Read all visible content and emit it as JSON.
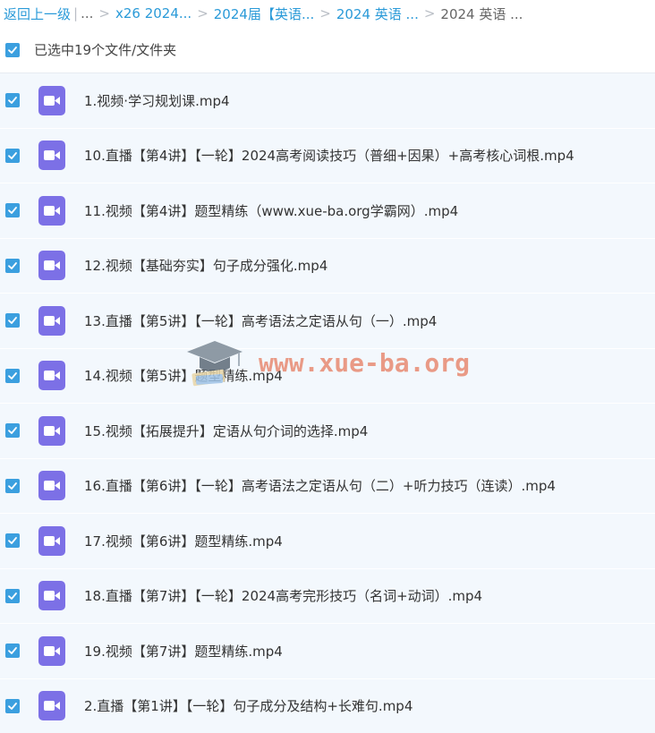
{
  "breadcrumb": {
    "back": "返回上一级",
    "divider": "|",
    "ellipsis": "...",
    "sep": ">",
    "crumbs": [
      "x26 2024...",
      "2024届【英语...",
      "2024 英语 ..."
    ],
    "current": "2024 英语 ..."
  },
  "selection": {
    "label": "已选中19个文件/文件夹"
  },
  "files": [
    {
      "name": "1.视频·学习规划课.mp4"
    },
    {
      "name": "10.直播【第4讲】【一轮】2024高考阅读技巧（普细+因果）+高考核心词根.mp4"
    },
    {
      "name": "11.视频【第4讲】题型精练（www.xue-ba.org学霸网）.mp4"
    },
    {
      "name": "12.视频【基础夯实】句子成分强化.mp4"
    },
    {
      "name": "13.直播【第5讲】【一轮】高考语法之定语从句（一）.mp4"
    },
    {
      "name": "14.视频【第5讲】题型精练.mp4"
    },
    {
      "name": "15.视频【拓展提升】定语从句介词的选择.mp4"
    },
    {
      "name": "16.直播【第6讲】【一轮】高考语法之定语从句（二）+听力技巧（连读）.mp4"
    },
    {
      "name": "17.视频【第6讲】题型精练.mp4"
    },
    {
      "name": "18.直播【第7讲】【一轮】2024高考完形技巧（名词+动词）.mp4"
    },
    {
      "name": "19.视频【第7讲】题型精练.mp4"
    },
    {
      "name": "2.直播【第1讲】【一轮】句子成分及结构+长难句.mp4"
    }
  ],
  "watermark": {
    "text": "www.xue-ba.org"
  },
  "icons": {
    "checkbox": "checkbox-checked-icon",
    "file": "video-file-icon",
    "logo": "graduation-cap-icon"
  },
  "colors": {
    "link": "#2a9ad8",
    "checkbox": "#3b9fdf",
    "video_icon": "#7c70e6",
    "row_bg": "#f3f8fd",
    "watermark": "#e88a72"
  }
}
